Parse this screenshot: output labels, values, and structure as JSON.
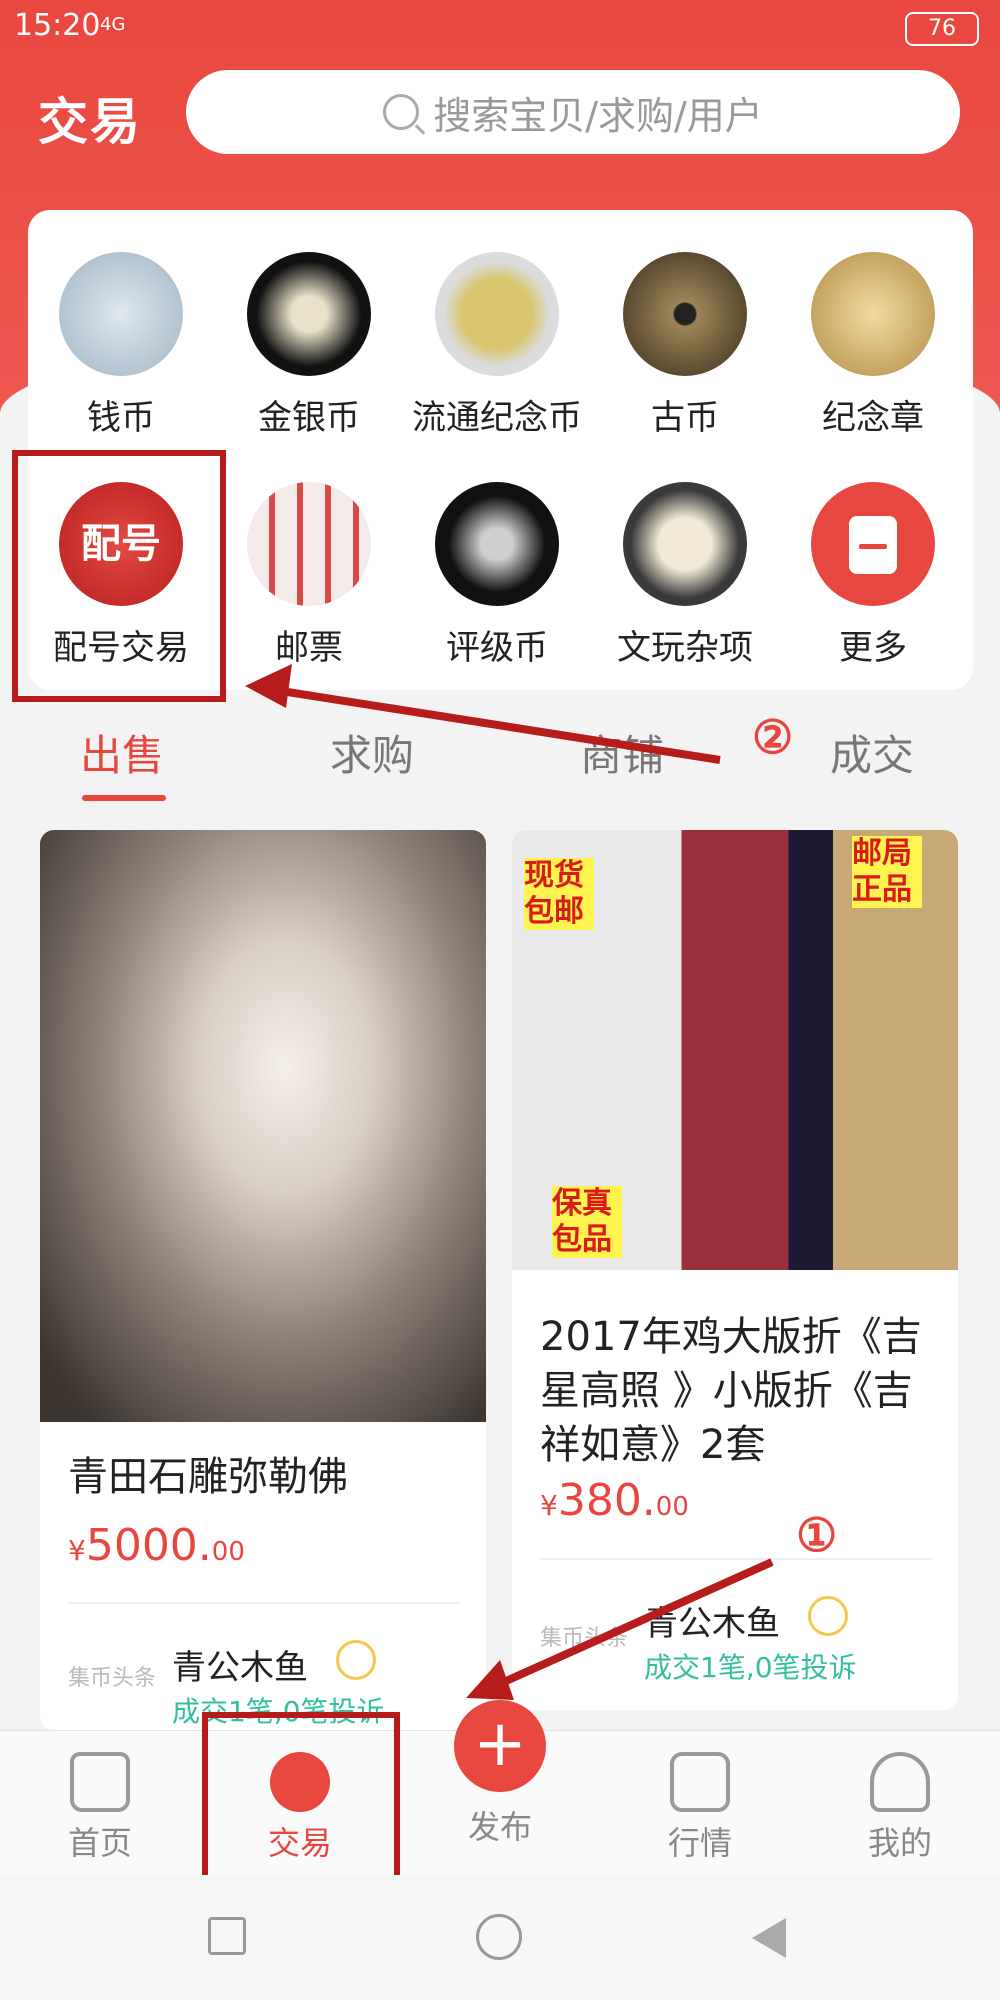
{
  "status_bar": {
    "time": "15:20",
    "network": "4G",
    "battery": "76"
  },
  "header": {
    "title": "交易",
    "search_placeholder": "搜索宝贝/求购/用户"
  },
  "categories": [
    {
      "label": "钱币",
      "color": "#b7c9d8"
    },
    {
      "label": "金银币",
      "color": "#222222"
    },
    {
      "label": "流通纪念币",
      "color": "#c8b46a"
    },
    {
      "label": "古币",
      "color": "#6b5a3e"
    },
    {
      "label": "纪念章",
      "color": "#caa86a"
    },
    {
      "label": "配号交易",
      "color": "#d93a3a",
      "badge": "配号"
    },
    {
      "label": "邮票",
      "color": "#e7d2cf"
    },
    {
      "label": "评级币",
      "color": "#1b1b1b"
    },
    {
      "label": "文玩杂项",
      "color": "#3b3b3b"
    },
    {
      "label": "更多",
      "color": "#e8473f"
    }
  ],
  "tabs": [
    {
      "label": "出售",
      "active": true
    },
    {
      "label": "求购",
      "active": false
    },
    {
      "label": "商铺",
      "active": false
    },
    {
      "label": "成交",
      "active": false
    }
  ],
  "products": [
    {
      "title": "青田石雕弥勒佛",
      "price_currency": "¥",
      "price_main": "5000.",
      "price_decimal": "00",
      "seller": "青公木鱼",
      "stats": "成交1笔,0笔投诉",
      "shop_tag": "集币头条"
    },
    {
      "title": "2017年鸡大版折《吉星高照 》小版折《吉祥如意》2套",
      "price_currency": "¥",
      "price_main": "380.",
      "price_decimal": "00",
      "seller": "青公木鱼",
      "stats": "成交1笔,0笔投诉",
      "shop_tag": "集币头条",
      "overlay_tags": [
        "现货包邮",
        "邮局正品",
        "保真包品"
      ]
    }
  ],
  "nav": {
    "items": [
      "首页",
      "交易",
      "发布",
      "行情",
      "我的"
    ],
    "active": "交易"
  },
  "annotations": {
    "step1": "①",
    "step2": "②"
  }
}
